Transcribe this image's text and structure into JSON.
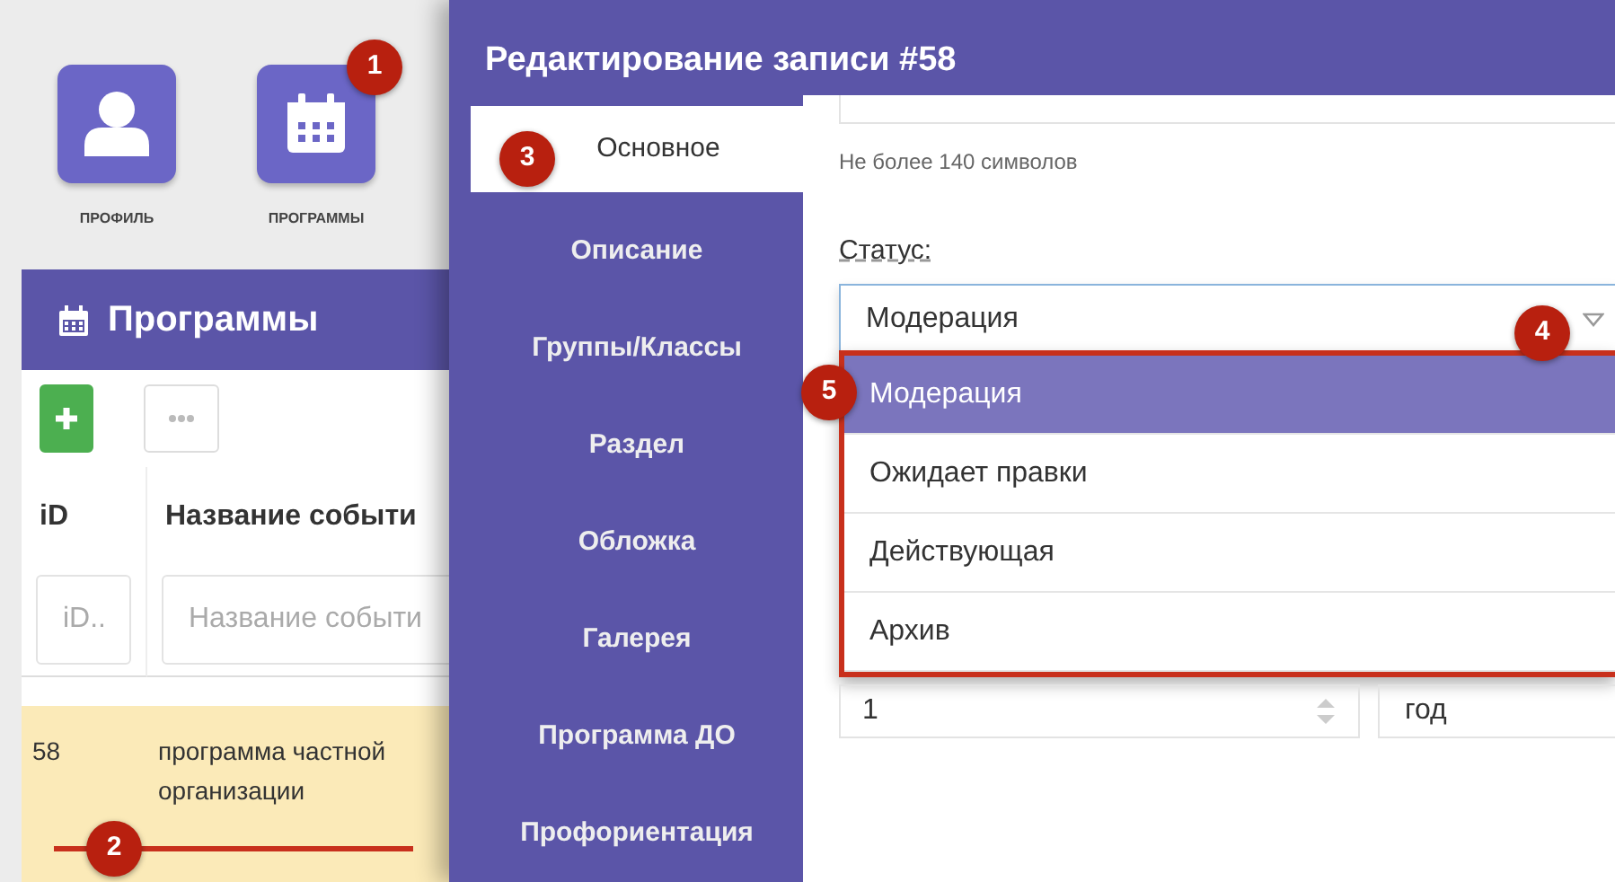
{
  "apps": [
    {
      "label": "ПРОФИЛЬ",
      "kind": "profile"
    },
    {
      "label": "ПРОГРАММЫ",
      "kind": "calendar"
    }
  ],
  "panel": {
    "title": "Программы",
    "toolbar": [
      {
        "kind": "add"
      },
      {
        "kind": "more"
      }
    ],
    "table": {
      "columns": [
        "iD",
        "Название событи"
      ],
      "filters": [
        {
          "placeholder": "iD.."
        },
        {
          "placeholder": "Название событи"
        }
      ],
      "rows": [
        {
          "cells": [
            "58",
            "программа частной организации"
          ],
          "selected": true
        }
      ]
    }
  },
  "modal": {
    "title": "Редактирование записи #58",
    "tabs": [
      {
        "label": "Основное",
        "selected": true
      },
      {
        "label": "Описание",
        "selected": false
      },
      {
        "label": "Группы/Классы",
        "selected": false
      },
      {
        "label": "Раздел",
        "selected": false
      },
      {
        "label": "Обложка",
        "selected": false
      },
      {
        "label": "Галерея",
        "selected": false
      },
      {
        "label": "Программа ДО",
        "selected": false
      },
      {
        "label": "Профориентация",
        "selected": false
      }
    ],
    "hint": "Не более 140 символов",
    "status": {
      "label": "Статус:",
      "value": "Модерация",
      "expanded": true,
      "options": [
        {
          "label": "Модерация",
          "selected": true
        },
        {
          "label": "Ожидает правки",
          "selected": false
        },
        {
          "label": "Действующая",
          "selected": false
        },
        {
          "label": "Архив",
          "selected": false
        }
      ]
    },
    "duration": {
      "value": "1",
      "unit": "год"
    }
  },
  "markers": [
    {
      "text": "1"
    },
    {
      "text": "2"
    },
    {
      "text": "3"
    },
    {
      "text": "4"
    },
    {
      "text": "5"
    }
  ]
}
